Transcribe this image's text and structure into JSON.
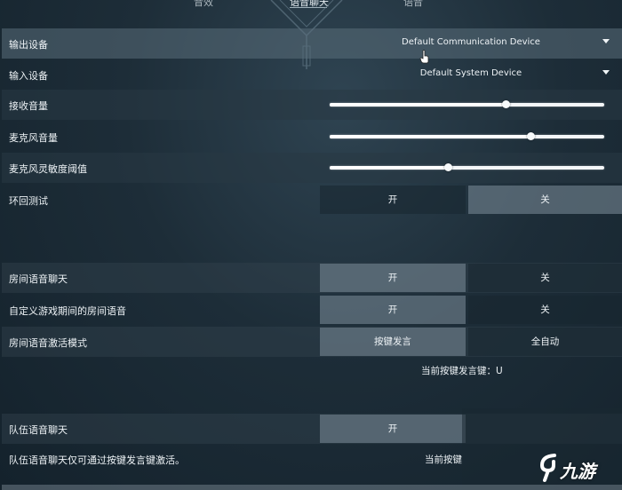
{
  "tabs": [
    {
      "label": "音效"
    },
    {
      "label": "语音聊天"
    },
    {
      "label": "语音"
    }
  ],
  "rows": {
    "output_device": {
      "label": "输出设备",
      "value": "Default Communication Device"
    },
    "input_device": {
      "label": "输入设备",
      "value": "Default System Device"
    },
    "receive_volume": {
      "label": "接收音量",
      "level": 0.64
    },
    "mic_volume": {
      "label": "麦克风音量",
      "level": 0.73
    },
    "mic_sensitivity": {
      "label": "麦克风灵敏度阈值",
      "level": 0.43
    },
    "loopback": {
      "label": "环回测试",
      "on": "开",
      "off": "关"
    },
    "party_voice": {
      "label": "房间语音聊天",
      "on": "开",
      "off": "关"
    },
    "custom_game_party_voice": {
      "label": "自定义游戏期间的房间语音",
      "on": "开",
      "off": "关"
    },
    "party_activation_mode": {
      "label": "房间语音激活模式",
      "option_a": "按键发言",
      "option_b": "全自动"
    },
    "team_voice": {
      "label": "队伍语音聊天",
      "on": "开"
    },
    "team_voice_note": {
      "label": "队伍语音聊天仅可通过按键发言键激活。"
    }
  },
  "hints": {
    "party_ptt_key": "当前按键发言键：U",
    "team_ptt_key": "当前按键"
  },
  "watermark": {
    "text": "九游"
  }
}
